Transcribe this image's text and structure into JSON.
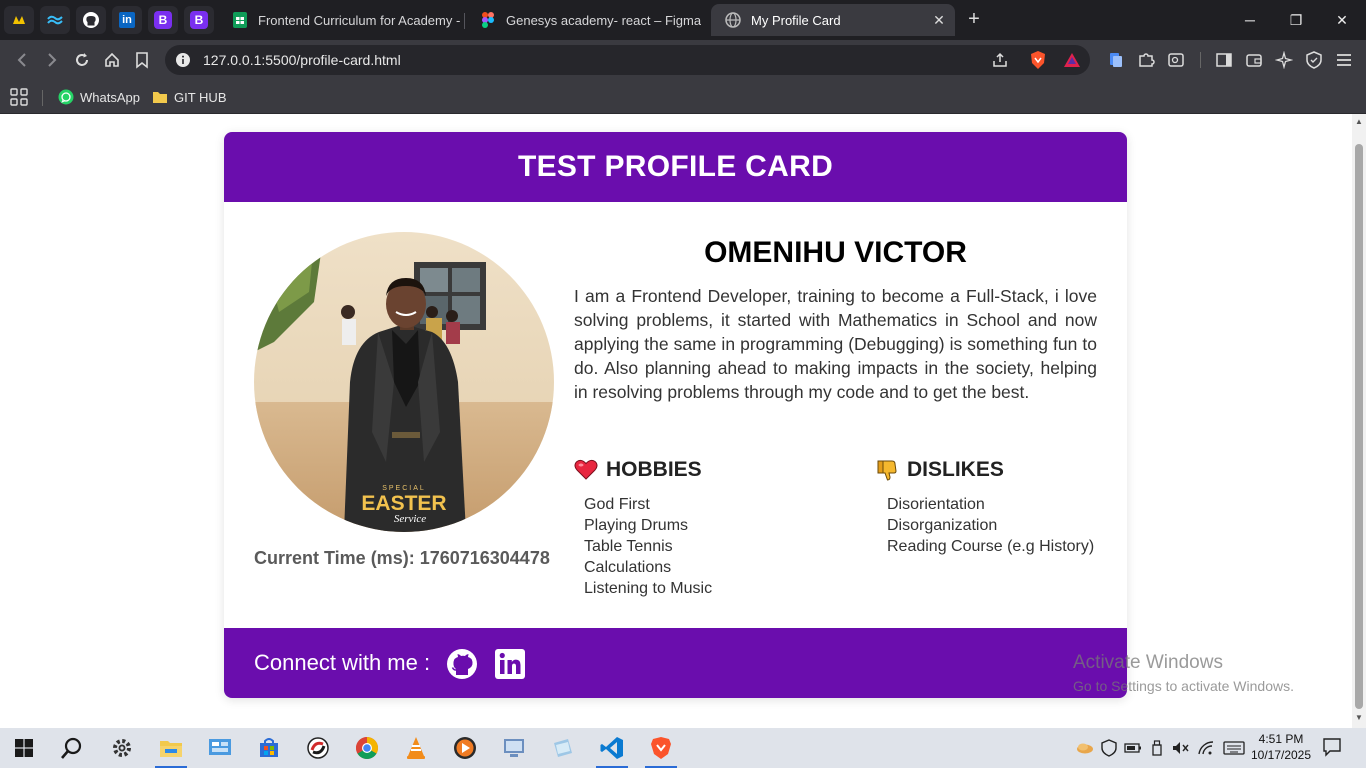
{
  "browser": {
    "pinned_tabs": [
      {
        "icon": "brave-rewards-icon"
      },
      {
        "icon": "tailwind-icon"
      },
      {
        "icon": "github-icon"
      },
      {
        "icon": "linkedin-icon",
        "text": "in"
      },
      {
        "icon": "bootstrap-icon",
        "text": "B"
      },
      {
        "icon": "bootstrap-icon",
        "text": "B"
      }
    ],
    "tabs": [
      {
        "title": "Frontend Curriculum for Academy - G",
        "icon": "google-sheets-icon"
      },
      {
        "title": "Genesys academy- react – Figma",
        "icon": "figma-icon"
      },
      {
        "title": "My Profile Card",
        "icon": "globe-icon",
        "active": true
      }
    ],
    "url": "127.0.0.1:5500/profile-card.html",
    "bookmarks": [
      {
        "label": "WhatsApp",
        "icon": "whatsapp-icon"
      },
      {
        "label": "GIT HUB",
        "icon": "folder-icon"
      }
    ]
  },
  "page": {
    "header_title": "TEST PROFILE CARD",
    "name": "OMENIHU VICTOR",
    "bio": "I am a Frontend Developer, training to become a Full-Stack, i love solving problems, it started with Mathematics in School and now applying the same in programming (Debugging) is something fun to do. Also planning ahead to making impacts in the society, helping in resolving problems through my code and to get the best.",
    "time_label": "Current Time (ms): ",
    "time_value": "1760716304478",
    "photo_caption_top": "SPECIAL",
    "photo_caption_main": "EASTER",
    "photo_caption_sub": "Service",
    "hobbies": {
      "title": "HOBBIES",
      "icon": "heart-icon",
      "items": [
        "God First",
        "Playing Drums",
        "Table Tennis",
        "Calculations",
        "Listening to Music"
      ]
    },
    "dislikes": {
      "title": "DISLIKES",
      "icon": "thumbs-down-icon",
      "items": [
        "Disorientation",
        "Disorganization",
        "Reading Course (e.g History)"
      ]
    },
    "footer": {
      "connect_label": "Connect with me :",
      "links": [
        {
          "icon": "github-icon"
        },
        {
          "icon": "linkedin-icon"
        }
      ]
    },
    "colors": {
      "primary": "#6a0dad",
      "background": "#ffffff"
    }
  },
  "watermark": {
    "line1": "Activate Windows",
    "line2": "Go to Settings to activate Windows."
  },
  "taskbar": {
    "time": "4:51 PM",
    "date": "10/17/2025"
  }
}
